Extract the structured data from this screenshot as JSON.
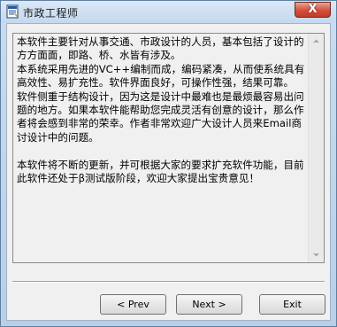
{
  "window": {
    "title": "市政工程师",
    "close_label": "X"
  },
  "content": {
    "text": "本软件主要针对从事交通、市政设计的人员，基本包括了设计的方方面面，即路、桥、水皆有涉及。\n本系统采用先进的VC++编制而成，编码紧凑，从而使系统具有高效性、易扩充性。软件界面良好，可操作性强，结果可靠。\n软件侧重于结构设计，因为这是设计中最难也是最烦最容易出问题的地方。如果本软件能帮助您完成灵活有创意的设计，那么作者将会感到非常的荣幸。作者非常欢迎广大设计人员来Email商讨设计中的问题。\n\n本软件将不断的更新，并可根据大家的要求扩充软件功能，目前此软件还处于β测试版阶段，欢迎大家提出宝贵意见！",
    "scroll_up_icon": "up-arrow",
    "scroll_down_icon": "down-arrow"
  },
  "buttons": {
    "prev": "< Prev",
    "next": "Next >",
    "exit": "Exit"
  }
}
